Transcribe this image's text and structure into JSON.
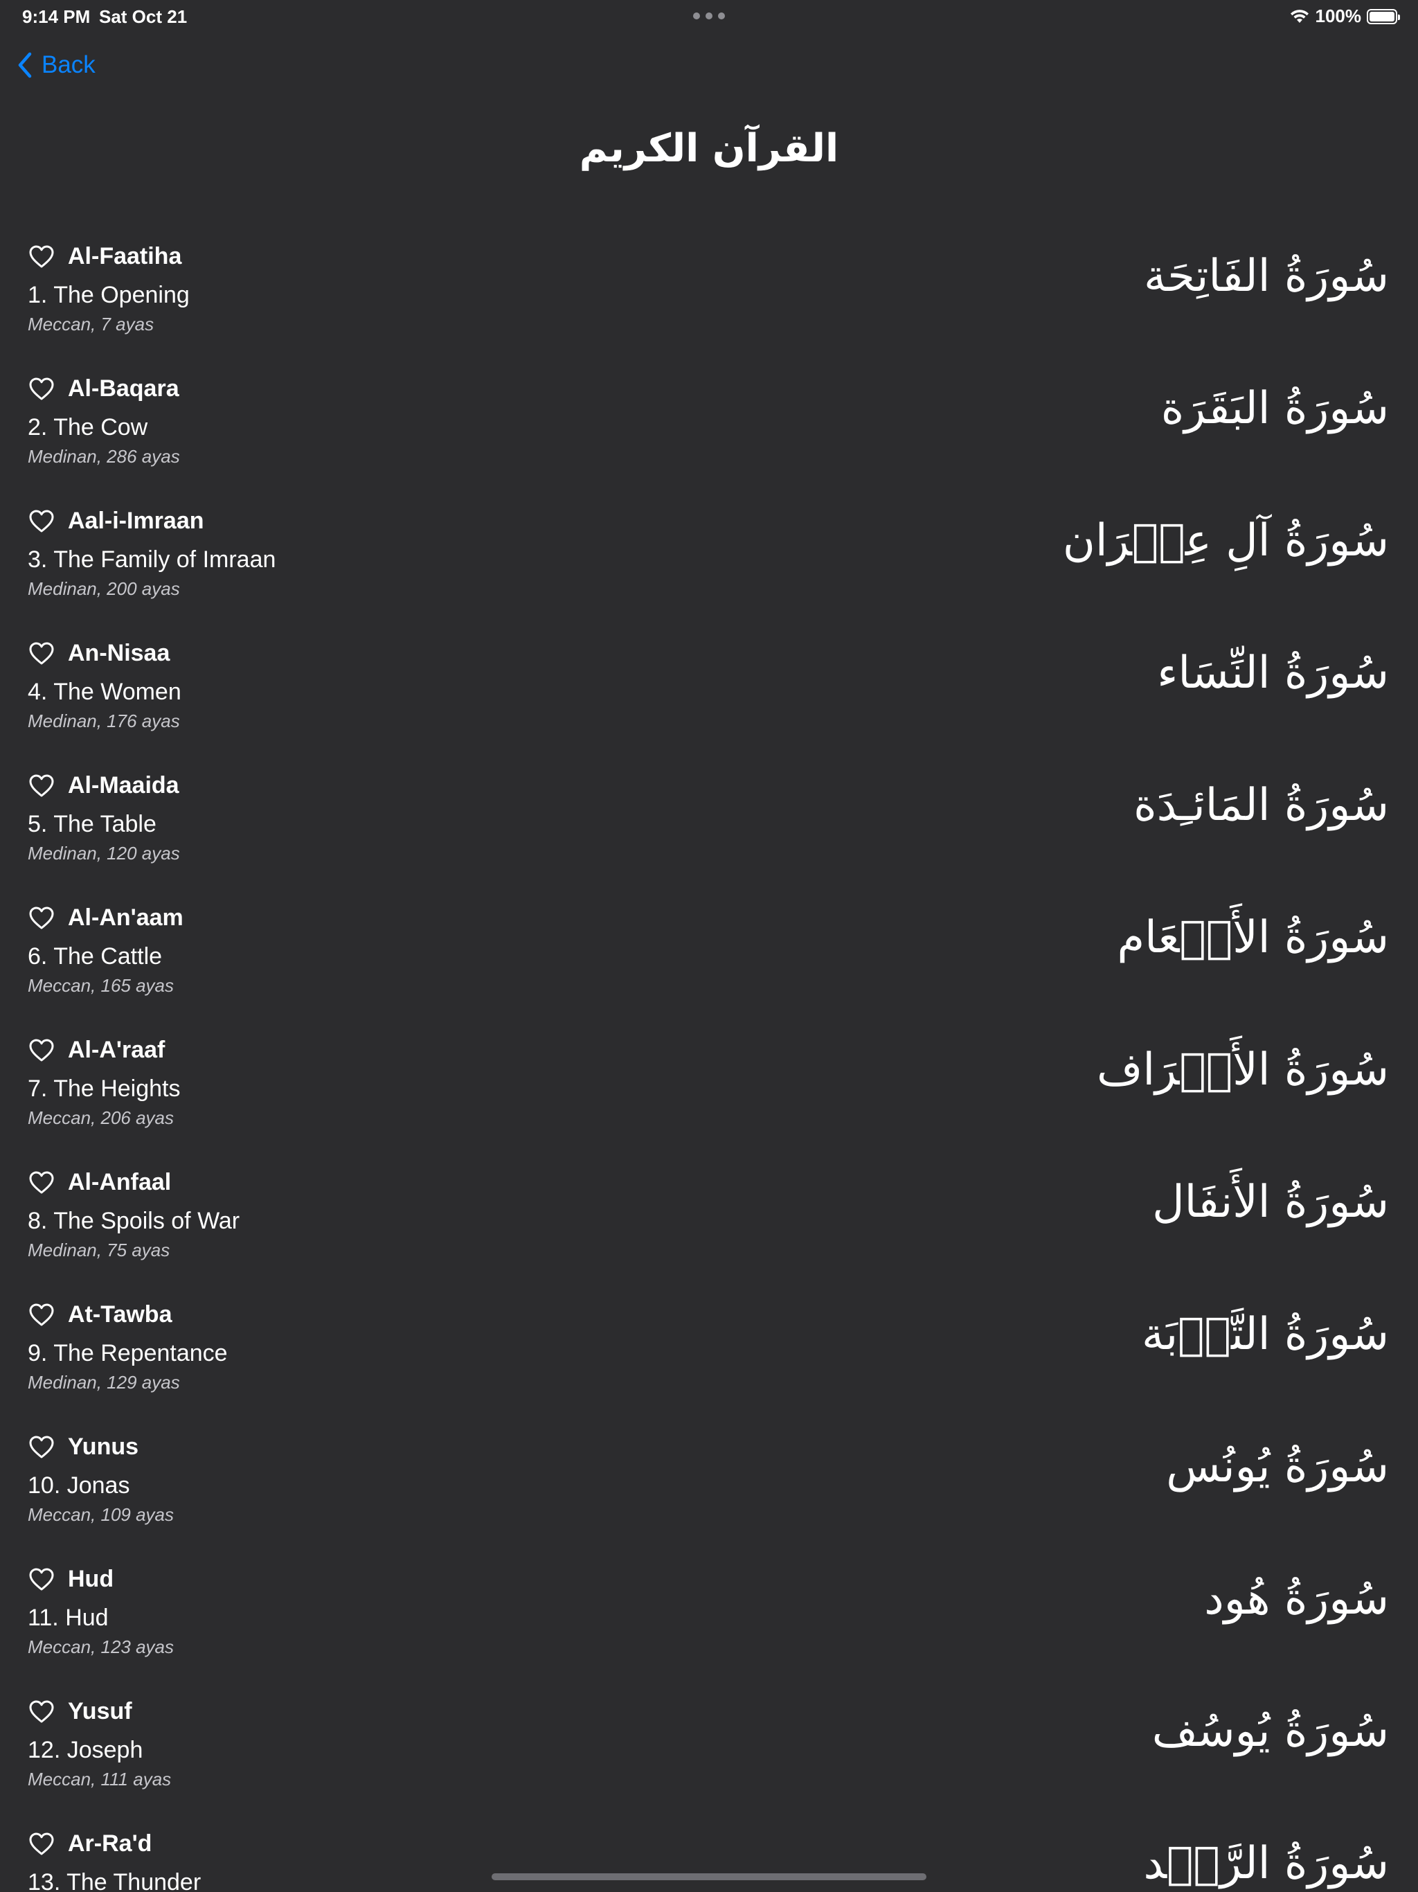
{
  "status_bar": {
    "time": "9:14 PM",
    "date": "Sat Oct 21",
    "battery": "100%",
    "battery_level": 1.0
  },
  "nav": {
    "back_label": "Back"
  },
  "title": "القرآن الكريم",
  "colors": {
    "background": "#2c2c2e",
    "accent": "#0a84ff",
    "text": "#ffffff",
    "secondary_text": "#c7c7cc"
  },
  "surahs": [
    {
      "translit": "Al-Faatiha",
      "english": "1. The Opening",
      "meta": "Meccan, 7 ayas",
      "arabic": "سُورَةُ الفَاتِحَة"
    },
    {
      "translit": "Al-Baqara",
      "english": "2. The Cow",
      "meta": "Medinan, 286 ayas",
      "arabic": "سُورَةُ البَقَرَة"
    },
    {
      "translit": "Aal-i-Imraan",
      "english": "3. The Family of Imraan",
      "meta": "Medinan, 200 ayas",
      "arabic": "سُورَةُ آلِ عِمۡرَان"
    },
    {
      "translit": "An-Nisaa",
      "english": "4. The Women",
      "meta": "Medinan, 176 ayas",
      "arabic": "سُورَةُ النِّسَاء"
    },
    {
      "translit": "Al-Maaida",
      "english": "5. The Table",
      "meta": "Medinan, 120 ayas",
      "arabic": "سُورَةُ المَائـِدَة"
    },
    {
      "translit": "Al-An'aam",
      "english": "6. The Cattle",
      "meta": "Meccan, 165 ayas",
      "arabic": "سُورَةُ الأَنۡعَام"
    },
    {
      "translit": "Al-A'raaf",
      "english": "7. The Heights",
      "meta": "Meccan, 206 ayas",
      "arabic": "سُورَةُ الأَعۡرَاف"
    },
    {
      "translit": "Al-Anfaal",
      "english": "8. The Spoils of War",
      "meta": "Medinan, 75 ayas",
      "arabic": "سُورَةُ الأَنفَال"
    },
    {
      "translit": "At-Tawba",
      "english": "9. The Repentance",
      "meta": "Medinan, 129 ayas",
      "arabic": "سُورَةُ التَّوۡبَة"
    },
    {
      "translit": "Yunus",
      "english": "10. Jonas",
      "meta": "Meccan, 109 ayas",
      "arabic": "سُورَةُ يُونُس"
    },
    {
      "translit": "Hud",
      "english": "11. Hud",
      "meta": "Meccan, 123 ayas",
      "arabic": "سُورَةُ هُود"
    },
    {
      "translit": "Yusuf",
      "english": "12. Joseph",
      "meta": "Meccan, 111 ayas",
      "arabic": "سُورَةُ يُوسُف"
    },
    {
      "translit": "Ar-Ra'd",
      "english": "13. The Thunder",
      "meta": "",
      "arabic": "سُورَةُ الرَّعۡد"
    }
  ]
}
